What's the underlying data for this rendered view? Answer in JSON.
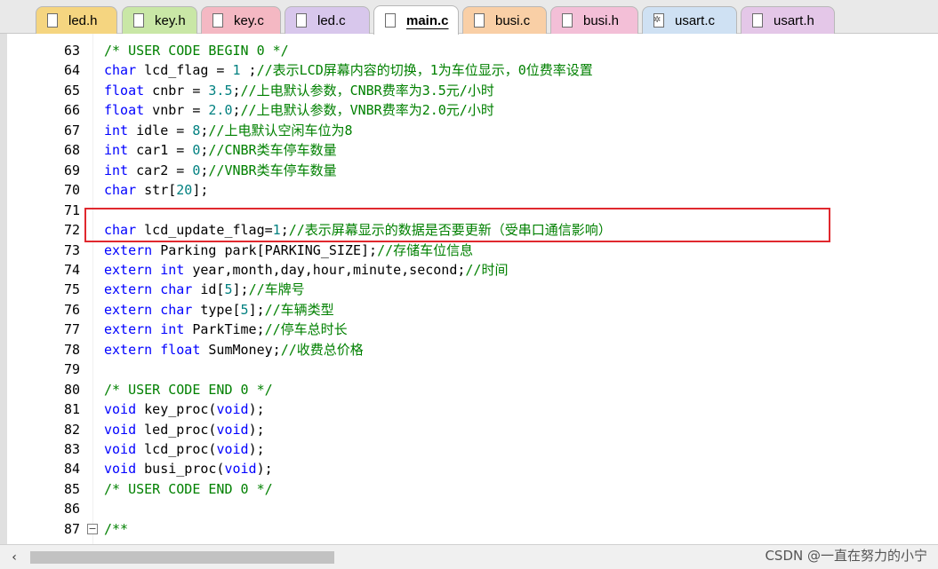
{
  "tabs": [
    {
      "label": "led.h",
      "color": "#f5d580",
      "icon": "file-icon"
    },
    {
      "label": "key.h",
      "color": "#c9e7a6",
      "icon": "file-icon"
    },
    {
      "label": "key.c",
      "color": "#f4b8c3",
      "icon": "file-icon"
    },
    {
      "label": "led.c",
      "color": "#d8c7ec",
      "icon": "file-icon"
    },
    {
      "label": "main.c",
      "color": "#ffffff",
      "icon": "file-icon",
      "active": true
    },
    {
      "label": "busi.c",
      "color": "#f9cfa6",
      "icon": "file-icon"
    },
    {
      "label": "busi.h",
      "color": "#f3bfd7",
      "icon": "file-icon"
    },
    {
      "label": "usart.c",
      "color": "#cfe1f3",
      "icon": "gear-file-icon"
    },
    {
      "label": "usart.h",
      "color": "#e4c7e8",
      "icon": "file-icon"
    }
  ],
  "lines": [
    {
      "num": "63",
      "code": "/* USER CODE BEGIN 0 */"
    },
    {
      "num": "64",
      "code": "char lcd_flag = 1 ;//表示LCD屏幕内容的切换，1为车位显示，0位费率设置"
    },
    {
      "num": "65",
      "code": "float cnbr = 3.5;//上电默认参数，CNBR费率为3.5元/小时"
    },
    {
      "num": "66",
      "code": "float vnbr = 2.0;//上电默认参数，VNBR费率为2.0元/小时"
    },
    {
      "num": "67",
      "code": "int idle = 8;//上电默认空闲车位为8"
    },
    {
      "num": "68",
      "code": "int car1 = 0;//CNBR类车停车数量"
    },
    {
      "num": "69",
      "code": "int car2 = 0;//VNBR类车停车数量"
    },
    {
      "num": "70",
      "code": "char str[20];"
    },
    {
      "num": "71",
      "code": ""
    },
    {
      "num": "72",
      "code": "char lcd_update_flag=1;//表示屏幕显示的数据是否要更新（受串口通信影响）"
    },
    {
      "num": "73",
      "code": "extern Parking park[PARKING_SIZE];//存储车位信息"
    },
    {
      "num": "74",
      "code": "extern int year,month,day,hour,minute,second;//时间"
    },
    {
      "num": "75",
      "code": "extern char id[5];//车牌号"
    },
    {
      "num": "76",
      "code": "extern char type[5];//车辆类型"
    },
    {
      "num": "77",
      "code": "extern int ParkTime;//停车总时长"
    },
    {
      "num": "78",
      "code": "extern float SumMoney;//收费总价格"
    },
    {
      "num": "79",
      "code": ""
    },
    {
      "num": "80",
      "code": "/* USER CODE END 0 */"
    },
    {
      "num": "81",
      "code": "void key_proc(void);"
    },
    {
      "num": "82",
      "code": "void led_proc(void);"
    },
    {
      "num": "83",
      "code": "void lcd_proc(void);"
    },
    {
      "num": "84",
      "code": "void busi_proc(void);"
    },
    {
      "num": "85",
      "code": "/* USER CODE END 0 */"
    },
    {
      "num": "86",
      "code": ""
    },
    {
      "num": "87",
      "code": "/**",
      "fold": true
    }
  ],
  "fold_symbol": "−",
  "scroll_left_arrow": "‹",
  "watermark": "CSDN @一直在努力的小宁",
  "colors": {
    "keyword": "#0000ff",
    "comment": "#008000",
    "number": "#008080",
    "highlight_box": "#e0282e"
  }
}
